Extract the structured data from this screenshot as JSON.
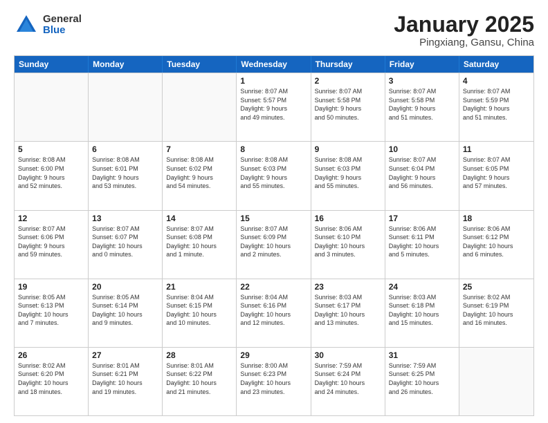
{
  "logo": {
    "general": "General",
    "blue": "Blue"
  },
  "title": {
    "month": "January 2025",
    "location": "Pingxiang, Gansu, China"
  },
  "header_days": [
    "Sunday",
    "Monday",
    "Tuesday",
    "Wednesday",
    "Thursday",
    "Friday",
    "Saturday"
  ],
  "weeks": [
    [
      {
        "day": "",
        "info": "",
        "empty": true
      },
      {
        "day": "",
        "info": "",
        "empty": true
      },
      {
        "day": "",
        "info": "",
        "empty": true
      },
      {
        "day": "1",
        "info": "Sunrise: 8:07 AM\nSunset: 5:57 PM\nDaylight: 9 hours\nand 49 minutes.",
        "empty": false
      },
      {
        "day": "2",
        "info": "Sunrise: 8:07 AM\nSunset: 5:58 PM\nDaylight: 9 hours\nand 50 minutes.",
        "empty": false
      },
      {
        "day": "3",
        "info": "Sunrise: 8:07 AM\nSunset: 5:58 PM\nDaylight: 9 hours\nand 51 minutes.",
        "empty": false
      },
      {
        "day": "4",
        "info": "Sunrise: 8:07 AM\nSunset: 5:59 PM\nDaylight: 9 hours\nand 51 minutes.",
        "empty": false
      }
    ],
    [
      {
        "day": "5",
        "info": "Sunrise: 8:08 AM\nSunset: 6:00 PM\nDaylight: 9 hours\nand 52 minutes.",
        "empty": false
      },
      {
        "day": "6",
        "info": "Sunrise: 8:08 AM\nSunset: 6:01 PM\nDaylight: 9 hours\nand 53 minutes.",
        "empty": false
      },
      {
        "day": "7",
        "info": "Sunrise: 8:08 AM\nSunset: 6:02 PM\nDaylight: 9 hours\nand 54 minutes.",
        "empty": false
      },
      {
        "day": "8",
        "info": "Sunrise: 8:08 AM\nSunset: 6:03 PM\nDaylight: 9 hours\nand 55 minutes.",
        "empty": false
      },
      {
        "day": "9",
        "info": "Sunrise: 8:08 AM\nSunset: 6:03 PM\nDaylight: 9 hours\nand 55 minutes.",
        "empty": false
      },
      {
        "day": "10",
        "info": "Sunrise: 8:07 AM\nSunset: 6:04 PM\nDaylight: 9 hours\nand 56 minutes.",
        "empty": false
      },
      {
        "day": "11",
        "info": "Sunrise: 8:07 AM\nSunset: 6:05 PM\nDaylight: 9 hours\nand 57 minutes.",
        "empty": false
      }
    ],
    [
      {
        "day": "12",
        "info": "Sunrise: 8:07 AM\nSunset: 6:06 PM\nDaylight: 9 hours\nand 59 minutes.",
        "empty": false
      },
      {
        "day": "13",
        "info": "Sunrise: 8:07 AM\nSunset: 6:07 PM\nDaylight: 10 hours\nand 0 minutes.",
        "empty": false
      },
      {
        "day": "14",
        "info": "Sunrise: 8:07 AM\nSunset: 6:08 PM\nDaylight: 10 hours\nand 1 minute.",
        "empty": false
      },
      {
        "day": "15",
        "info": "Sunrise: 8:07 AM\nSunset: 6:09 PM\nDaylight: 10 hours\nand 2 minutes.",
        "empty": false
      },
      {
        "day": "16",
        "info": "Sunrise: 8:06 AM\nSunset: 6:10 PM\nDaylight: 10 hours\nand 3 minutes.",
        "empty": false
      },
      {
        "day": "17",
        "info": "Sunrise: 8:06 AM\nSunset: 6:11 PM\nDaylight: 10 hours\nand 5 minutes.",
        "empty": false
      },
      {
        "day": "18",
        "info": "Sunrise: 8:06 AM\nSunset: 6:12 PM\nDaylight: 10 hours\nand 6 minutes.",
        "empty": false
      }
    ],
    [
      {
        "day": "19",
        "info": "Sunrise: 8:05 AM\nSunset: 6:13 PM\nDaylight: 10 hours\nand 7 minutes.",
        "empty": false
      },
      {
        "day": "20",
        "info": "Sunrise: 8:05 AM\nSunset: 6:14 PM\nDaylight: 10 hours\nand 9 minutes.",
        "empty": false
      },
      {
        "day": "21",
        "info": "Sunrise: 8:04 AM\nSunset: 6:15 PM\nDaylight: 10 hours\nand 10 minutes.",
        "empty": false
      },
      {
        "day": "22",
        "info": "Sunrise: 8:04 AM\nSunset: 6:16 PM\nDaylight: 10 hours\nand 12 minutes.",
        "empty": false
      },
      {
        "day": "23",
        "info": "Sunrise: 8:03 AM\nSunset: 6:17 PM\nDaylight: 10 hours\nand 13 minutes.",
        "empty": false
      },
      {
        "day": "24",
        "info": "Sunrise: 8:03 AM\nSunset: 6:18 PM\nDaylight: 10 hours\nand 15 minutes.",
        "empty": false
      },
      {
        "day": "25",
        "info": "Sunrise: 8:02 AM\nSunset: 6:19 PM\nDaylight: 10 hours\nand 16 minutes.",
        "empty": false
      }
    ],
    [
      {
        "day": "26",
        "info": "Sunrise: 8:02 AM\nSunset: 6:20 PM\nDaylight: 10 hours\nand 18 minutes.",
        "empty": false
      },
      {
        "day": "27",
        "info": "Sunrise: 8:01 AM\nSunset: 6:21 PM\nDaylight: 10 hours\nand 19 minutes.",
        "empty": false
      },
      {
        "day": "28",
        "info": "Sunrise: 8:01 AM\nSunset: 6:22 PM\nDaylight: 10 hours\nand 21 minutes.",
        "empty": false
      },
      {
        "day": "29",
        "info": "Sunrise: 8:00 AM\nSunset: 6:23 PM\nDaylight: 10 hours\nand 23 minutes.",
        "empty": false
      },
      {
        "day": "30",
        "info": "Sunrise: 7:59 AM\nSunset: 6:24 PM\nDaylight: 10 hours\nand 24 minutes.",
        "empty": false
      },
      {
        "day": "31",
        "info": "Sunrise: 7:59 AM\nSunset: 6:25 PM\nDaylight: 10 hours\nand 26 minutes.",
        "empty": false
      },
      {
        "day": "",
        "info": "",
        "empty": true
      }
    ]
  ]
}
